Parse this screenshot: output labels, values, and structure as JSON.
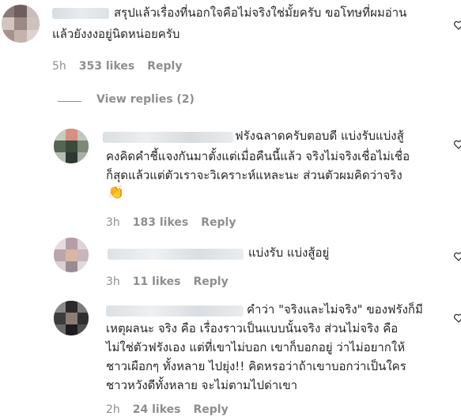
{
  "comments": [
    {
      "text_lines": [
        "สรุปแล้วเรื่องที่นอกใจคือไม่จริงใช่มั้ยครับ ขอโทษที่ผมอ่าน",
        "แล้วยังงงอยู่นิดหน่อยครับ"
      ],
      "time": "5h",
      "likes": "353 likes",
      "reply": "Reply"
    },
    {
      "text_lines": [
        "ฟรังฉลาดครับตอบดี แบ่งรับแบ่งสู้",
        "คงคิดคำชี้แจงกันมาตั้งแต่เมื่อคืนนี้แล้ว จริงไม่จริงเชื่อไม่เชื่อ",
        "ก็สุดแล้วแต่ตัวเราจะวิเคราะห์แหละนะ ส่วนตัวผมคิดว่าจริง",
        "👏"
      ],
      "time": "3h",
      "likes": "183 likes",
      "reply": "Reply"
    },
    {
      "text_lines": [
        "แบ่งรับ แบ่งสู้อยู่"
      ],
      "time": "3h",
      "likes": "11 likes",
      "reply": "Reply"
    },
    {
      "text_lines": [
        "คำว่า \"จริงและไม่จริง\" ของฟรังก็มี",
        "เหตุผลนะ จริง คือ เรื่องราวเป็นแบบนั้นจริง ส่วนไม่จริง คือ",
        "ไม่ใช่ตัวฟรังเอง แต่ที่เขาไม่บอก เขาก็บอกอยู่ ว่าไม่อยากให้",
        "ชาวเผือกๆ ทั้งหลาย ไปยุ่ง!! คิดหรอว่าถ้าเขาบอกว่าเป็นใคร",
        "ชาวหวังดีทั้งหลาย จะไม่ตามไปด่าเขา"
      ],
      "time": "2h",
      "likes": "24 likes",
      "reply": "Reply"
    }
  ],
  "view_replies": "View replies (2)"
}
